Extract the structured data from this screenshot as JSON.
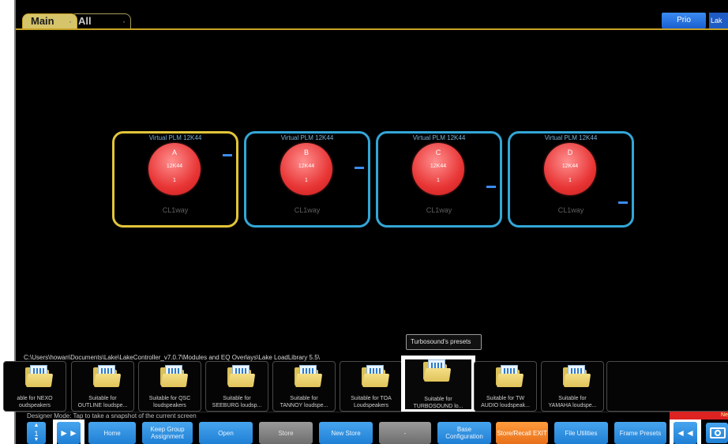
{
  "tabs": [
    {
      "label": "Main",
      "dots": "·"
    },
    {
      "label": "All",
      "dots": "·"
    }
  ],
  "top_right": {
    "prio_label": "Prio",
    "lake_label": "Lak"
  },
  "devices": [
    {
      "title": "Virtual PLM 12K44",
      "letter": "A",
      "model": "12K44",
      "number": "1",
      "footer": "CL1way",
      "selected": true
    },
    {
      "title": "Virtual PLM 12K44",
      "letter": "B",
      "model": "12K44",
      "number": "1",
      "footer": "CL1way",
      "selected": false
    },
    {
      "title": "Virtual PLM 12K44",
      "letter": "C",
      "model": "12K44",
      "number": "1",
      "footer": "CL1way",
      "selected": false
    },
    {
      "title": "Virtual PLM 12K44",
      "letter": "D",
      "model": "12K44",
      "number": "1",
      "footer": "CL1way",
      "selected": false
    }
  ],
  "path": "C:\\Users\\howan\\Documents\\Lake\\LakeController_v7.0.7\\Modules and EQ Overlays\\Lake LoadLibrary 5.5\\",
  "tooltip": "Turbosound's presets",
  "presets": [
    {
      "line1": "able for NEXO",
      "line2": "oudspeakers"
    },
    {
      "line1": "Suitable for",
      "line2": "OUTLINE loudspe..."
    },
    {
      "line1": "Suitable for QSC",
      "line2": "loudspeakers"
    },
    {
      "line1": "Suitable for",
      "line2": "SEEBURG loudsp..."
    },
    {
      "line1": "Suitable for",
      "line2": "TANNOY loudspe..."
    },
    {
      "line1": "Suitable for TOA",
      "line2": "Loudspeakers"
    },
    {
      "line1": "Suitable for",
      "line2": "TURBOSOUND lo..."
    },
    {
      "line1": "Suitable for TW",
      "line2": "AUDIO loudspeak..."
    },
    {
      "line1": "Suitable for",
      "line2": "YAMAHA loudspe..."
    }
  ],
  "status": {
    "text": "Designer Mode: Tap to take a snapshot of the current screen",
    "indicator": "Ne"
  },
  "bottom": {
    "page_up": "▲",
    "page_number": "1",
    "page_down": "▼",
    "forward": "►►",
    "home": "Home",
    "keep_group": "Keep Group Assignment",
    "open": "Open",
    "store": "Store",
    "new_store": "New Store",
    "dash": "-",
    "base_config": "Base Configuration",
    "store_recall_exit": "Store/Recall EXIT",
    "file_utilities": "File Utilities",
    "frame_presets": "Frame Presets",
    "back": "◄◄"
  }
}
